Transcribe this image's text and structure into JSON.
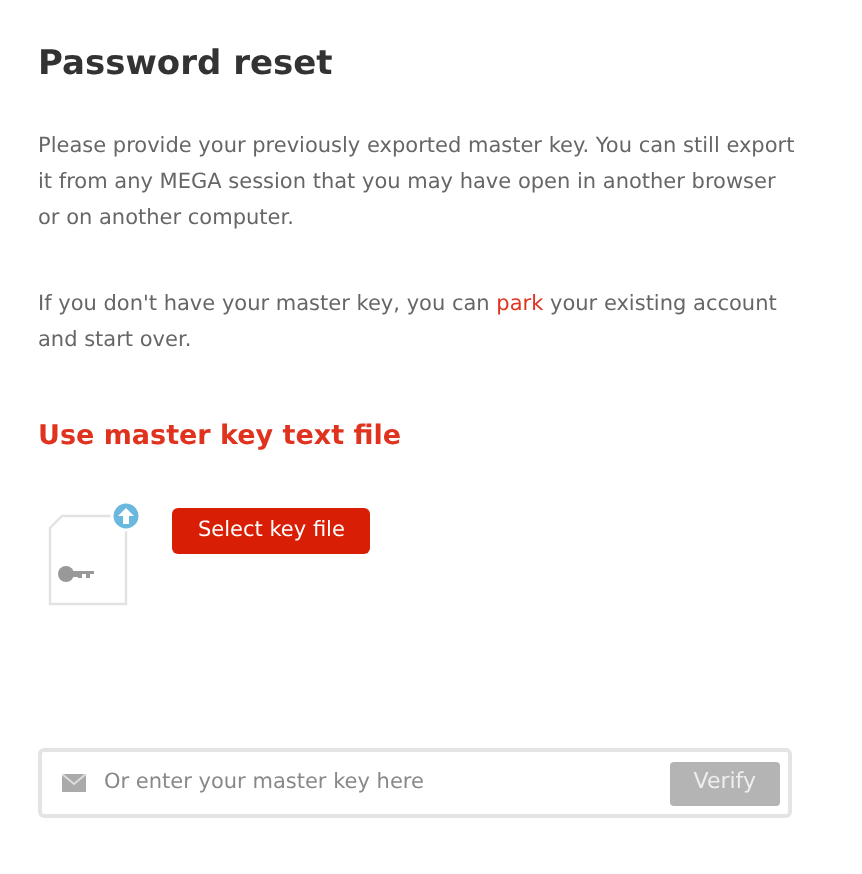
{
  "title": "Password reset",
  "intro": "Please provide your previously exported master key. You can still export it from any MEGA session that you may have open in another browser or on another computer.",
  "park_note": {
    "before": "If you don't have your master key, you can ",
    "link": "park",
    "after": " your existing account and start over."
  },
  "section_title": "Use master key text file",
  "select_button": "Select key file",
  "key_field": {
    "placeholder": "Or enter your master key here"
  },
  "verify_button": {
    "label": "Verify",
    "disabled": true
  }
}
